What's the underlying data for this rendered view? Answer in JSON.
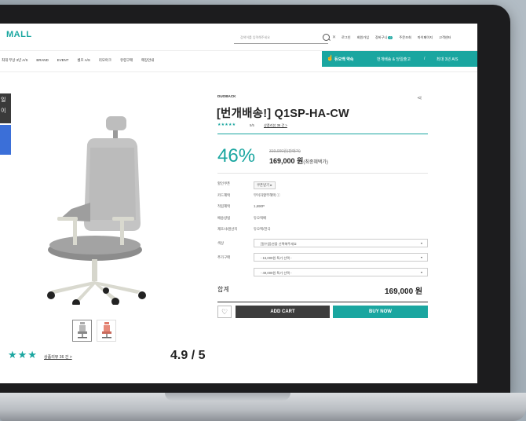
{
  "header": {
    "logo": "MALL",
    "search_placeholder": "검색어를 입력해주세요",
    "utility_links": [
      "로그인",
      "회원가입",
      "장바구니",
      "주문조회",
      "마이페이지",
      "고객센터"
    ],
    "cart_count": "0"
  },
  "nav": {
    "items": [
      "최대 무상 3년 A/S",
      "BRAND",
      "EVENT",
      "셀프 A/S",
      "리모아크",
      "유령구매",
      "매장안내"
    ]
  },
  "promo": {
    "label": "듀오백 약속",
    "item1": "번개배송 & 당일출고",
    "divider": "/",
    "item2": "최대 3년 A/S"
  },
  "side_tab": {
    "line1": "일",
    "line2": "이"
  },
  "product": {
    "brand": "DUOBACK",
    "title": "[번개배송!] Q1SP-HA-CW",
    "stars_small": "★★★★★",
    "score_small": "5/5",
    "review_small": "상품리뷰 36 건 >",
    "discount": "46%",
    "original_price": "319,000원(판매가)",
    "price": "169,000 원",
    "price_note": "(최종혜택가)",
    "info": [
      {
        "key": "할인쿠폰",
        "value": "쿠폰받기 ▸"
      },
      {
        "key": "카드혜택",
        "value": "무이자할부혜택 ⓘ"
      },
      {
        "key": "적립혜택",
        "value": "1,690P"
      },
      {
        "key": "배송방법",
        "value": "듀오택배"
      },
      {
        "key": "제조사/원산지",
        "value": "듀오백/한국"
      }
    ],
    "options": [
      {
        "label": "색상",
        "value": "[필수]옵션을 선택해주세요",
        "arrow": "▾"
      },
      {
        "label": "추가구매",
        "value": "- 15,000원 특가 선택 -",
        "arrow": "▾"
      },
      {
        "label": "",
        "value": "- 49,000원 특가 선택 -",
        "arrow": "▾"
      }
    ],
    "total_label": "합계",
    "total_value": "169,000 원",
    "add_cart": "ADD CART",
    "buy_now": "BUY NOW"
  },
  "review_summary": {
    "stars": "★★★",
    "link": "상품리뷰 36 건 >",
    "rating": "4.9 / 5"
  },
  "colors": {
    "accent": "#1aa6a0",
    "dark": "#3d3d3d"
  }
}
